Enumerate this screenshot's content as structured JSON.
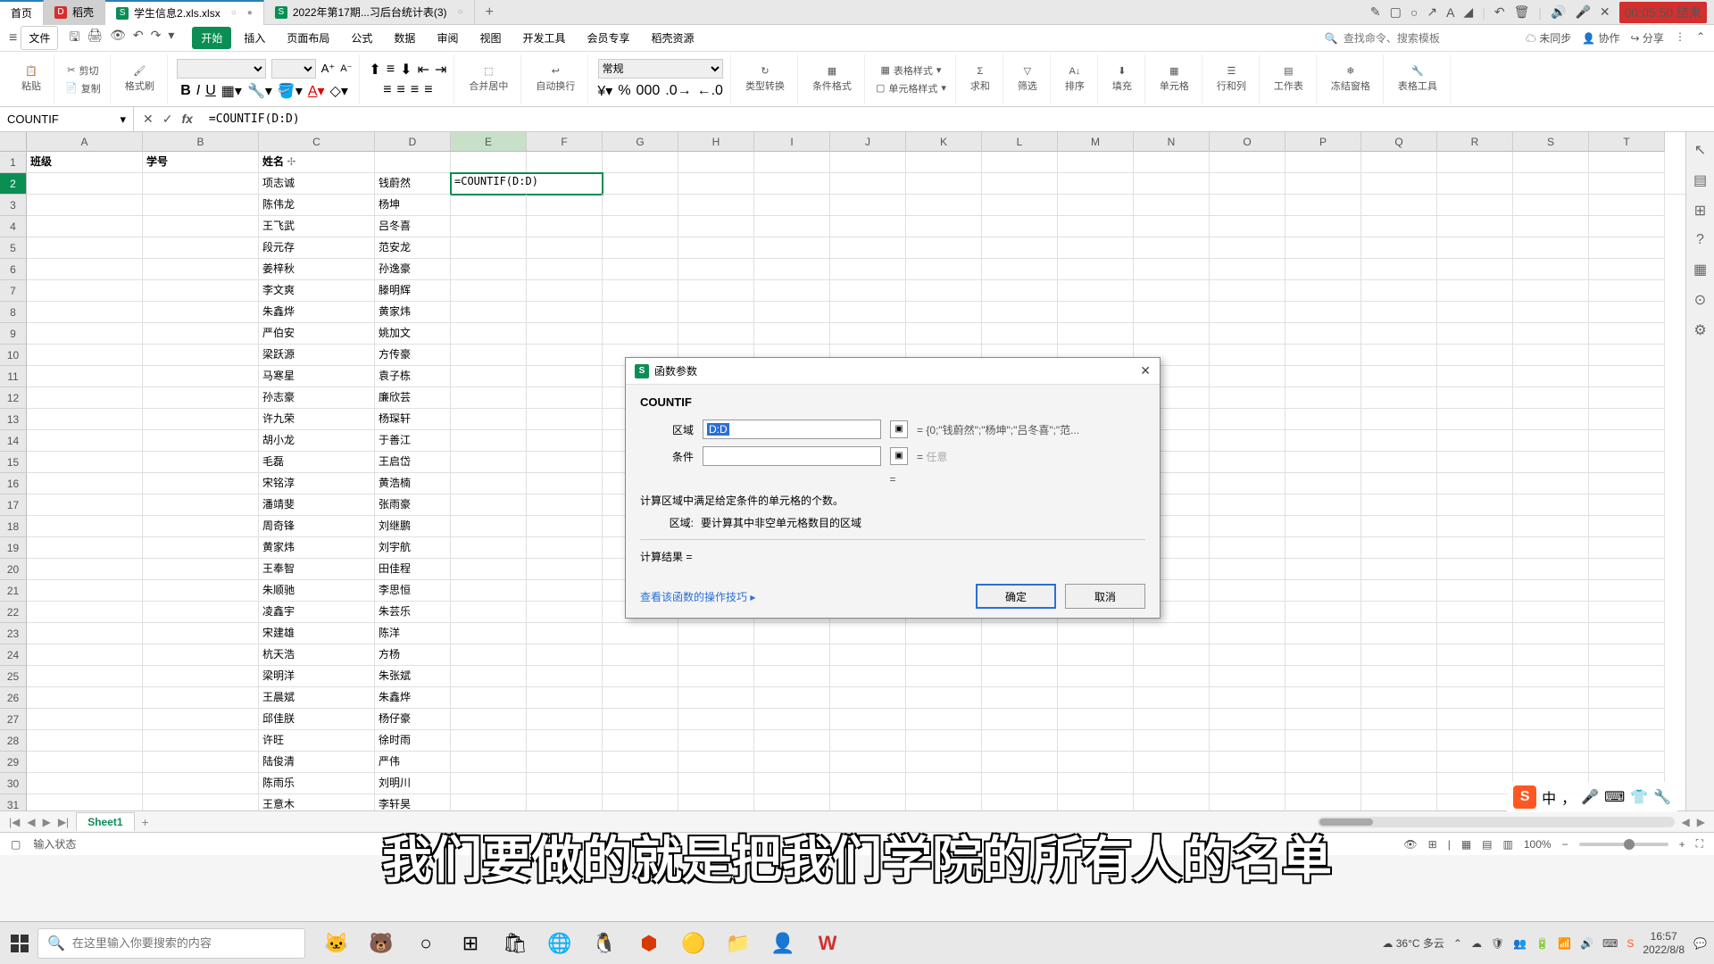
{
  "top_tabs": {
    "home": "首页",
    "app": "稻壳",
    "doc1": "学生信息2.xls.xlsx",
    "doc2": "2022年第17期...习后台统计表(3)"
  },
  "timer": "00:05:50 结束",
  "menu": {
    "file": "文件",
    "tabs": [
      "开始",
      "插入",
      "页面布局",
      "公式",
      "数据",
      "审阅",
      "视图",
      "开发工具",
      "会员专享",
      "稻壳资源"
    ],
    "active": 0,
    "search_placeholder": "查找命令、搜索模板",
    "right": {
      "sync": "未同步",
      "coop": "协作",
      "share": "分享"
    }
  },
  "ribbon": {
    "paste": "粘贴",
    "cut": "剪切",
    "copy": "复制",
    "format_painter": "格式刷",
    "number_format": "常规",
    "merge": "合并居中",
    "wrap": "自动换行",
    "type_convert": "类型转换",
    "cond_format": "条件格式",
    "table_style": "表格样式",
    "cell_style": "单元格样式",
    "sum": "求和",
    "filter": "筛选",
    "sort": "排序",
    "fill": "填充",
    "cell": "单元格",
    "rowcol": "行和列",
    "worksheet": "工作表",
    "freeze": "冻结窗格",
    "table_tools": "表格工具"
  },
  "name_box": "COUNTIF",
  "formula": "=COUNTIF(D:D)",
  "columns": [
    "A",
    "B",
    "C",
    "D",
    "E",
    "F",
    "G",
    "H",
    "I",
    "J",
    "K",
    "L",
    "M",
    "N",
    "O",
    "P",
    "Q",
    "R",
    "S",
    "T"
  ],
  "headers": {
    "A": "班级",
    "B": "学号",
    "C": "姓名"
  },
  "col_c": [
    "项志诚",
    "陈伟龙",
    "王飞武",
    "段元存",
    "姜梓秋",
    "李文爽",
    "朱鑫烨",
    "严伯安",
    "梁跃源",
    "马寒星",
    "孙志豪",
    "许九荣",
    "胡小龙",
    "毛磊",
    "宋铭淳",
    "潘靖斐",
    "周奇锋",
    "黄家炜",
    "王奉智",
    "朱顺驰",
    "凌鑫宇",
    "宋建雄",
    "杭天浩",
    "梁明洋",
    "王晨斌",
    "邱佳朕",
    "许旺",
    "陆俊清",
    "陈雨乐",
    "王意木"
  ],
  "col_d": [
    "钱蔚然",
    "杨坤",
    "吕冬喜",
    "范安龙",
    "孙逸豪",
    "滕明辉",
    "黄家炜",
    "姚加文",
    "方传豪",
    "袁子栋",
    "廉欣芸",
    "杨琛轩",
    "于善江",
    "王启岱",
    "黄浩楠",
    "张雨豪",
    "刘继鹏",
    "刘宇航",
    "田佳程",
    "李思恒",
    "朱芸乐",
    "陈洋",
    "方杨",
    "朱张斌",
    "朱鑫烨",
    "杨仔豪",
    "徐时雨",
    "严伟",
    "刘明川",
    "李轩昊"
  ],
  "e2": "=COUNTIF(D:D)",
  "dialog": {
    "title": "函数参数",
    "fn": "COUNTIF",
    "p1_label": "区域",
    "p1_value": "D:D",
    "p1_result": "= {0;\"钱蔚然\";\"杨坤\";\"吕冬喜\";\"范...",
    "p2_label": "条件",
    "p2_hint": "任意",
    "eq": "=",
    "desc": "计算区域中满足给定条件的单元格的个数。",
    "param_desc_label": "区域:",
    "param_desc": "要计算其中非空单元格数目的区域",
    "result_label": "计算结果 =",
    "link": "查看该函数的操作技巧",
    "ok": "确定",
    "cancel": "取消"
  },
  "subtitle": "我们要做的就是把我们学院的所有人的名单",
  "sheet_tab": "Sheet1",
  "status": {
    "mode": "输入状态",
    "zoom": "100%"
  },
  "taskbar": {
    "search_placeholder": "在这里输入你要搜索的内容",
    "weather": "36°C 多云",
    "time": "16:57",
    "date": "2022/8/8"
  },
  "ime": {
    "lang": "中"
  }
}
